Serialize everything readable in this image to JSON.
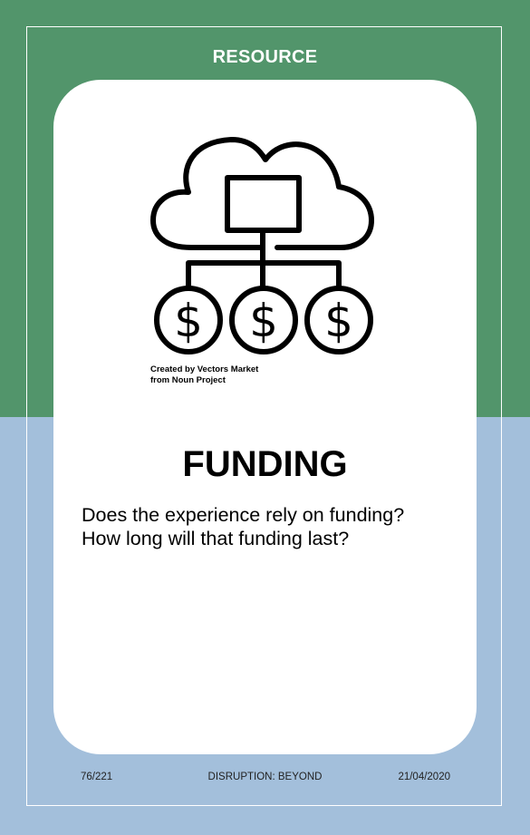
{
  "card": {
    "category": "RESOURCE",
    "title": "FUNDING",
    "questions": [
      "Does the experience rely on funding?",
      "How long will that funding last?"
    ],
    "icon": "cloud-funding-icon",
    "credit": [
      "Created by Vectors Market",
      "from Noun Project"
    ]
  },
  "footer": {
    "card_number": "76/221",
    "deck_name": "DISRUPTION: BEYOND",
    "date": "21/04/2020"
  },
  "colors": {
    "top_background": "#52956b",
    "bottom_background": "#a3bfdb",
    "card": "#ffffff"
  }
}
